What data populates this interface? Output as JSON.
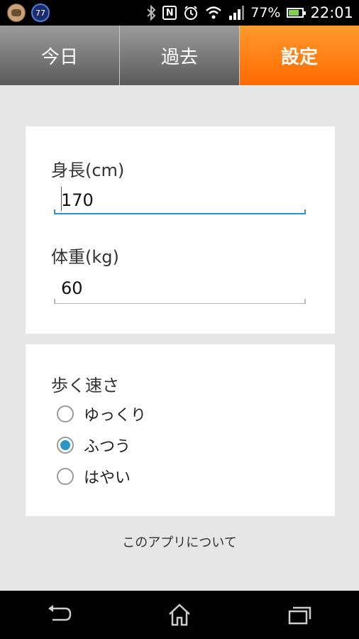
{
  "status_bar": {
    "notification_badge": "77",
    "battery_percent": "77%",
    "time": "22:01",
    "icons": [
      "notification-app-icon",
      "notification-badge-icon",
      "bluetooth-icon",
      "nfc-icon",
      "alarm-icon",
      "wifi-icon",
      "signal-icon",
      "battery-icon"
    ],
    "nfc_label": "N"
  },
  "tabs": [
    {
      "label": "今日",
      "active": false
    },
    {
      "label": "過去",
      "active": false
    },
    {
      "label": "設定",
      "active": true
    }
  ],
  "form": {
    "height": {
      "label": "身長(cm)",
      "value": "170"
    },
    "weight": {
      "label": "体重(kg)",
      "value": "60"
    }
  },
  "walking_speed": {
    "label": "歩く速さ",
    "options": [
      {
        "label": "ゆっくり",
        "checked": false
      },
      {
        "label": "ふつう",
        "checked": true
      },
      {
        "label": "はやい",
        "checked": false
      }
    ]
  },
  "about_link": "このアプリについて",
  "nav_bar": {
    "icons": [
      "back-icon",
      "home-icon",
      "recent-apps-icon"
    ]
  },
  "colors": {
    "accent": "#ff7a10",
    "focus": "#2b97c9"
  }
}
